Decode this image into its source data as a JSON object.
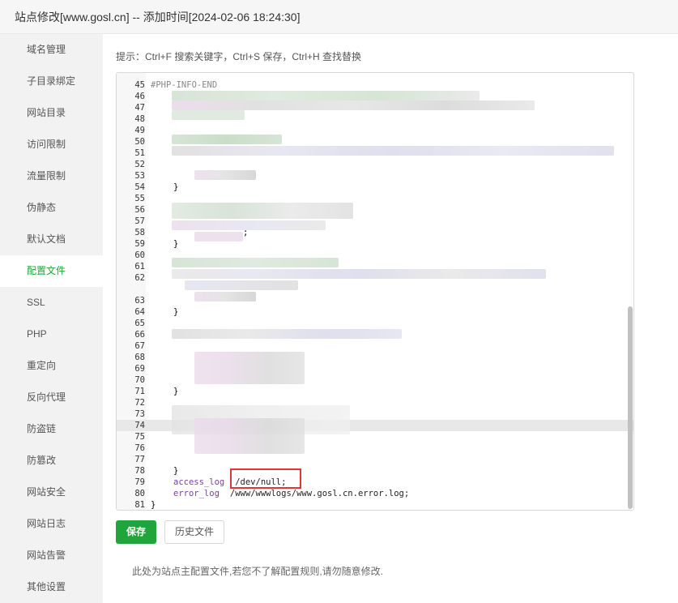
{
  "window": {
    "title": "站点修改[www.gosl.cn] -- 添加时间[2024-02-06 18:24:30]"
  },
  "sidebar": {
    "items": [
      {
        "label": "域名管理"
      },
      {
        "label": "子目录绑定"
      },
      {
        "label": "网站目录"
      },
      {
        "label": "访问限制"
      },
      {
        "label": "流量限制"
      },
      {
        "label": "伪静态"
      },
      {
        "label": "默认文档"
      },
      {
        "label": "配置文件",
        "active": true
      },
      {
        "label": "SSL"
      },
      {
        "label": "PHP"
      },
      {
        "label": "重定向"
      },
      {
        "label": "反向代理"
      },
      {
        "label": "防盗链"
      },
      {
        "label": "防篡改"
      },
      {
        "label": "网站安全"
      },
      {
        "label": "网站日志"
      },
      {
        "label": "网站告警"
      },
      {
        "label": "其他设置"
      }
    ]
  },
  "editor": {
    "hint": "提示：Ctrl+F 搜索关键字，Ctrl+S 保存，Ctrl+H 查找替换",
    "top_partial": "#PHP-INFO-END",
    "line_numbers": [
      "45",
      "46",
      "47",
      "48",
      "49",
      "50",
      "51",
      "52",
      "53",
      "54",
      "55",
      "56",
      "57",
      "58",
      "59",
      "60",
      "61",
      "62",
      "63",
      "64",
      "65",
      "66",
      "67",
      "68",
      "69",
      "70",
      "71",
      "72",
      "73",
      "74",
      "75",
      "76",
      "77",
      "78",
      "79",
      "80",
      "81"
    ],
    "brace_lines": {
      "54": "}",
      "59": "}",
      "64": "}",
      "71": "}",
      "78": "}",
      "81": "}"
    },
    "line_58_tail": ";",
    "access_log_key": "access_log",
    "access_log_value": "/dev/null;",
    "error_log_key": "error_log",
    "error_log_value": "/www/wwwlogs/www.gosl.cn.error.log;"
  },
  "buttons": {
    "save": "保存",
    "history": "历史文件"
  },
  "footnote": "此处为站点主配置文件,若您不了解配置规则,请勿随意修改."
}
